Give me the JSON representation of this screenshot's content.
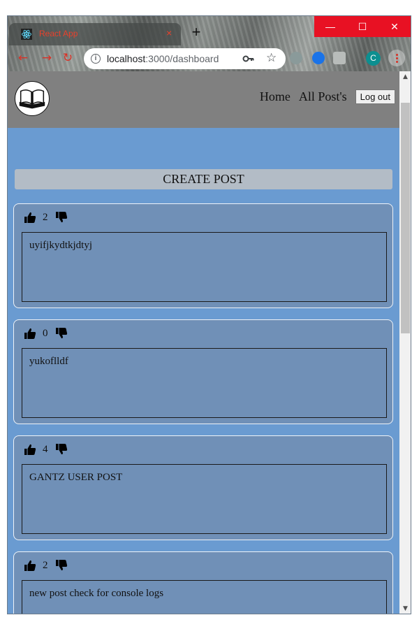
{
  "browser": {
    "tab_title": "React App",
    "tab_close": "×",
    "new_tab": "+",
    "url_host": "localhost",
    "url_path": ":3000/dashboard",
    "profile_initial": "C",
    "controls": {
      "minimize": "—",
      "maximize": "☐",
      "close": "✕"
    }
  },
  "header": {
    "nav": [
      {
        "label": "Home"
      },
      {
        "label": "All Post's"
      }
    ],
    "logout_label": "Log out"
  },
  "create_post_label": "CREATE POST",
  "posts": [
    {
      "likes": "2",
      "body": "uyifjkydtkjdtyj"
    },
    {
      "likes": "0",
      "body": "yukoflldf"
    },
    {
      "likes": "4",
      "body": "GANTZ USER POST"
    },
    {
      "likes": "2",
      "body": "new post check for console logs"
    }
  ],
  "colors": {
    "page_bg": "#6a9bd1",
    "header_bg": "#808080",
    "post_bg": "#7090b7",
    "create_post_bg": "#b3bcc6",
    "window_close_red": "#e81123"
  }
}
